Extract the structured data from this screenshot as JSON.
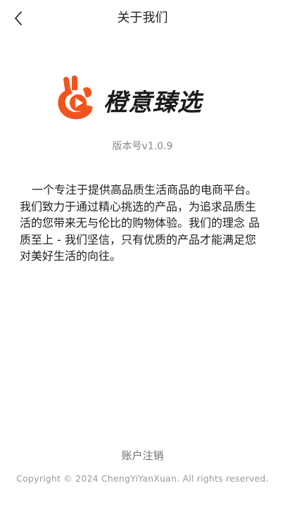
{
  "header": {
    "title": "关于我们",
    "back_icon": "chevron-left-icon"
  },
  "logo": {
    "brand_name": "橙意臻选",
    "icon": "hand-play-logo",
    "brand_color": "#F2541E",
    "play_color": "#FFFFFF"
  },
  "version": {
    "text": "版本号v1.0.9"
  },
  "intro": {
    "text": "一个专注于提供高品质生活商品的电商平台。我们致力于通过精心挑选的产品，为追求品质生活的您带来无与伦比的购物体验。我们的理念 品质至上 - 我们坚信，只有优质的产品才能满足您对美好生活的向往。"
  },
  "footer": {
    "cancel_account_label": "账户注销",
    "copyright": "Copyright © 2024 ChengYiYanXuan. All rights reserved."
  }
}
